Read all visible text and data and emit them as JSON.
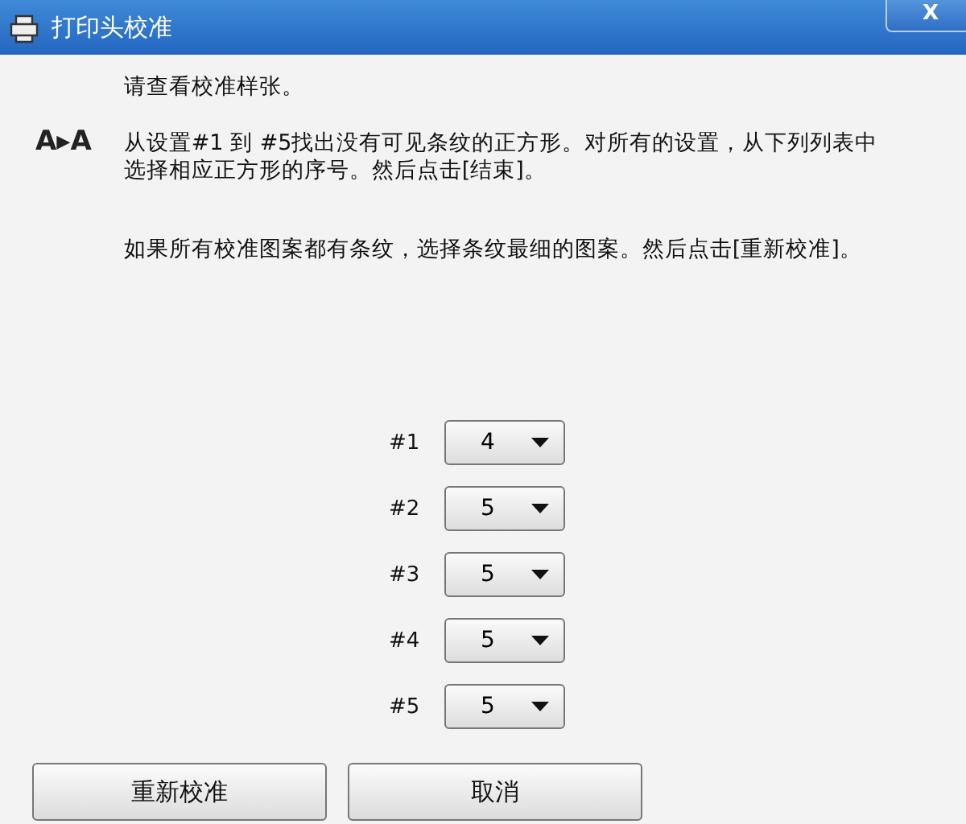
{
  "window": {
    "title": "打印头校准",
    "close": "X"
  },
  "logo_text": "A▸A",
  "instructions": [
    "请查看校准样张。",
    "从设置#1 到 #5找出没有可见条纹的正方形。对所有的设置，从下列列表中选择相应正方形的序号。然后点击[结束]。",
    "如果所有校准图案都有条纹，选择条纹最细的图案。然后点击[重新校准]。"
  ],
  "settings": [
    {
      "label": "#1",
      "value": "4"
    },
    {
      "label": "#2",
      "value": "5"
    },
    {
      "label": "#3",
      "value": "5"
    },
    {
      "label": "#4",
      "value": "5"
    },
    {
      "label": "#5",
      "value": "5"
    }
  ],
  "buttons": [
    "重新校准",
    "取消"
  ]
}
